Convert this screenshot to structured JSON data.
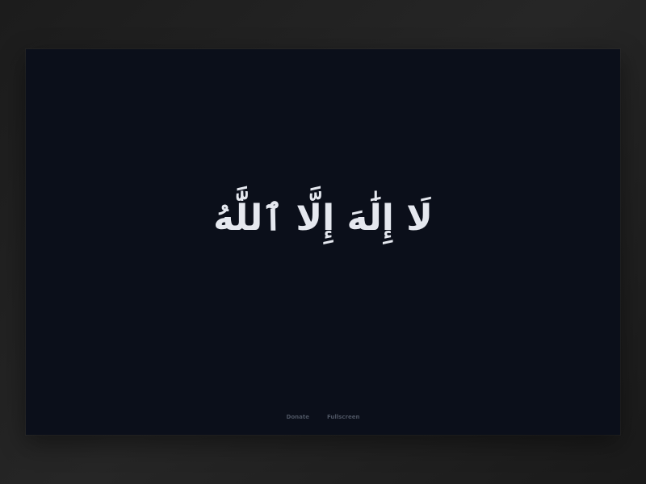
{
  "main": {
    "phrase": "لَا إِلَٰهَ إِلَّا ٱللَّٰهُ"
  },
  "footer": {
    "donate_label": "Donate",
    "fullscreen_label": "Fullscreen"
  },
  "colors": {
    "background": "#0b0f1a",
    "outer_background": "#1f1f1f",
    "text": "#e5e8ef",
    "footer_text": "#4d5462"
  }
}
